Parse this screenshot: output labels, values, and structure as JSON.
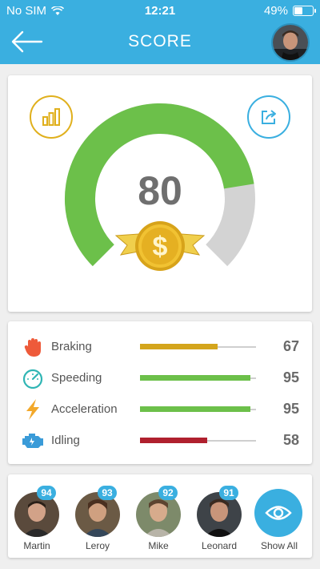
{
  "status_bar": {
    "carrier": "No SIM",
    "time": "12:21",
    "battery": "49%",
    "battery_level": 0.49
  },
  "header": {
    "title": "SCORE",
    "back_icon": "arrow-left-icon",
    "avatar": "user-avatar"
  },
  "score": {
    "value": "80",
    "gauge_fraction": 0.8,
    "colors": {
      "filled": "#6cc04a",
      "empty": "#d3d3d3"
    },
    "chart_icon": "bar-chart-icon",
    "share_icon": "share-icon",
    "badge_icon": "dollar-medal-icon"
  },
  "stats": [
    {
      "label": "Braking",
      "value": "67",
      "fraction": 0.67,
      "color": "#d4a51c",
      "icon": "hand-stop-icon"
    },
    {
      "label": "Speeding",
      "value": "95",
      "fraction": 0.95,
      "color": "#6cc04a",
      "icon": "speedometer-icon"
    },
    {
      "label": "Acceleration",
      "value": "95",
      "fraction": 0.95,
      "color": "#6cc04a",
      "icon": "lightning-icon"
    },
    {
      "label": "Idling",
      "value": "58",
      "fraction": 0.58,
      "color": "#b0202e",
      "icon": "engine-icon"
    }
  ],
  "friends": [
    {
      "name": "Martin",
      "score": "94"
    },
    {
      "name": "Leroy",
      "score": "93"
    },
    {
      "name": "Mike",
      "score": "92"
    },
    {
      "name": "Leonard",
      "score": "91"
    }
  ],
  "show_all": {
    "label": "Show All",
    "icon": "eye-icon"
  }
}
